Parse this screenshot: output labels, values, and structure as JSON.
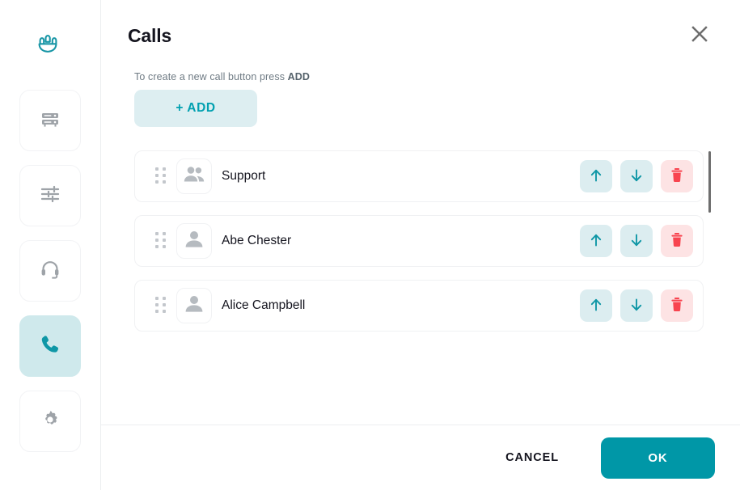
{
  "colors": {
    "accent_teal": "#0097a7",
    "accent_teal_light": "#ddeef1",
    "nav_active_bg": "#cfe9ec",
    "danger_red": "#f8444f",
    "danger_bg": "#fde3e4",
    "action_bg": "#dcedf0",
    "icon_gray": "#9ea3a8",
    "text_dark": "#14141e",
    "text_muted": "#6f7b84",
    "border": "#eceef0"
  },
  "sidebar": {
    "logo_icon": "people-group-icon",
    "items": [
      {
        "icon": "server-rack-icon",
        "name": "sidebar-item-devices",
        "active": false
      },
      {
        "icon": "sliders-icon",
        "name": "sidebar-item-settings-tuning",
        "active": false
      },
      {
        "icon": "headset-icon",
        "name": "sidebar-item-audio",
        "active": false
      },
      {
        "icon": "phone-icon",
        "name": "sidebar-item-calls",
        "active": true
      },
      {
        "icon": "gear-icon",
        "name": "sidebar-item-configuration",
        "active": false
      }
    ]
  },
  "header": {
    "title": "Calls",
    "close_icon": "close-icon"
  },
  "body": {
    "hint_prefix": "To create a new call button press ",
    "hint_emphasis": "ADD",
    "add_button_label": "+ ADD",
    "scrollbar": "list-scrollbar"
  },
  "list": {
    "items": [
      {
        "label": "Support",
        "avatar_icon": "people-group-avatar-icon",
        "drag_icon": "drag-handle-icon",
        "move_up_icon": "arrow-up-icon",
        "move_down_icon": "arrow-down-icon",
        "delete_icon": "trash-icon"
      },
      {
        "label": "Abe Chester",
        "avatar_icon": "person-avatar-icon",
        "drag_icon": "drag-handle-icon",
        "move_up_icon": "arrow-up-icon",
        "move_down_icon": "arrow-down-icon",
        "delete_icon": "trash-icon"
      },
      {
        "label": "Alice Campbell",
        "avatar_icon": "person-avatar-icon",
        "drag_icon": "drag-handle-icon",
        "move_up_icon": "arrow-up-icon",
        "move_down_icon": "arrow-down-icon",
        "delete_icon": "trash-icon"
      }
    ]
  },
  "footer": {
    "cancel_label": "CANCEL",
    "ok_label": "OK"
  }
}
